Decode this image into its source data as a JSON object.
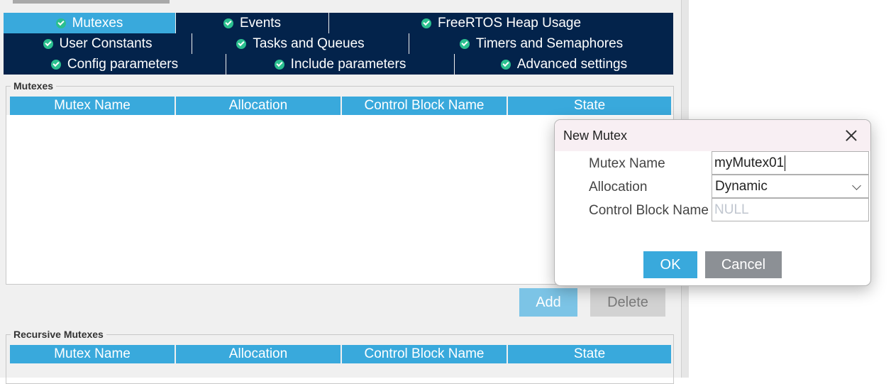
{
  "tabs": {
    "row1": [
      {
        "label": "Mutexes",
        "active": true
      },
      {
        "label": "Events",
        "active": false
      },
      {
        "label": "FreeRTOS Heap Usage",
        "active": false
      }
    ],
    "row2": [
      {
        "label": "User Constants"
      },
      {
        "label": "Tasks and Queues"
      },
      {
        "label": "Timers and Semaphores"
      }
    ],
    "row3": [
      {
        "label": "Config parameters"
      },
      {
        "label": "Include parameters"
      },
      {
        "label": "Advanced settings"
      }
    ]
  },
  "mutexes": {
    "title": "Mutexes",
    "columns": [
      "Mutex Name",
      "Allocation",
      "Control Block Name",
      "State"
    ],
    "add_label": "Add",
    "delete_label": "Delete"
  },
  "recursive": {
    "title": "Recursive Mutexes",
    "columns": [
      "Mutex Name",
      "Allocation",
      "Control Block Name",
      "State"
    ]
  },
  "dialog": {
    "title": "New Mutex",
    "name_label": "Mutex Name",
    "name_value": "myMutex01",
    "allocation_label": "Allocation",
    "allocation_value": "Dynamic",
    "cb_label": "Control Block Name",
    "cb_placeholder": "NULL",
    "ok_label": "OK",
    "cancel_label": "Cancel"
  },
  "colors": {
    "tab_dark": "#03234b",
    "tab_active": "#39a9dc",
    "header": "#39a9dc",
    "ok_button": "#39a9dc",
    "cancel_button": "#8c9095",
    "add_disabled": "#7cc4e6",
    "delete_disabled": "#d2d2d2"
  }
}
